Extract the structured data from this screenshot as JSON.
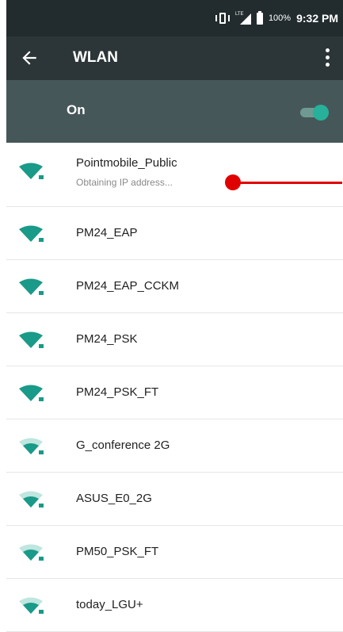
{
  "status_bar": {
    "battery_percent": "100%",
    "time": "9:32 PM",
    "network_label": "LTE",
    "icons": [
      "vibrate-icon",
      "signal-icon",
      "battery-icon"
    ]
  },
  "toolbar": {
    "title": "WLAN",
    "back_icon": "arrow-left-icon",
    "menu_icon": "more-vert-icon"
  },
  "wifi_toggle": {
    "label": "On",
    "state": true
  },
  "networks": [
    {
      "name": "Pointmobile_Public",
      "status": "Obtaining IP address...",
      "signal": "strong",
      "secured": true
    },
    {
      "name": "PM24_EAP",
      "status": "",
      "signal": "strong",
      "secured": true
    },
    {
      "name": "PM24_EAP_CCKM",
      "status": "",
      "signal": "strong",
      "secured": true
    },
    {
      "name": "PM24_PSK",
      "status": "",
      "signal": "strong",
      "secured": true
    },
    {
      "name": "PM24_PSK_FT",
      "status": "",
      "signal": "strong",
      "secured": true
    },
    {
      "name": "G_conference 2G",
      "status": "",
      "signal": "medium",
      "secured": true
    },
    {
      "name": "ASUS_E0_2G",
      "status": "",
      "signal": "medium",
      "secured": true
    },
    {
      "name": "PM50_PSK_FT",
      "status": "",
      "signal": "medium",
      "secured": true
    },
    {
      "name": "today_LGU+",
      "status": "",
      "signal": "medium",
      "secured": true
    }
  ],
  "colors": {
    "status_bar": "#222c2f",
    "toolbar": "#2c3538",
    "switch_bar": "#46575a",
    "accent": "#27b09a",
    "marker": "#e00000"
  }
}
